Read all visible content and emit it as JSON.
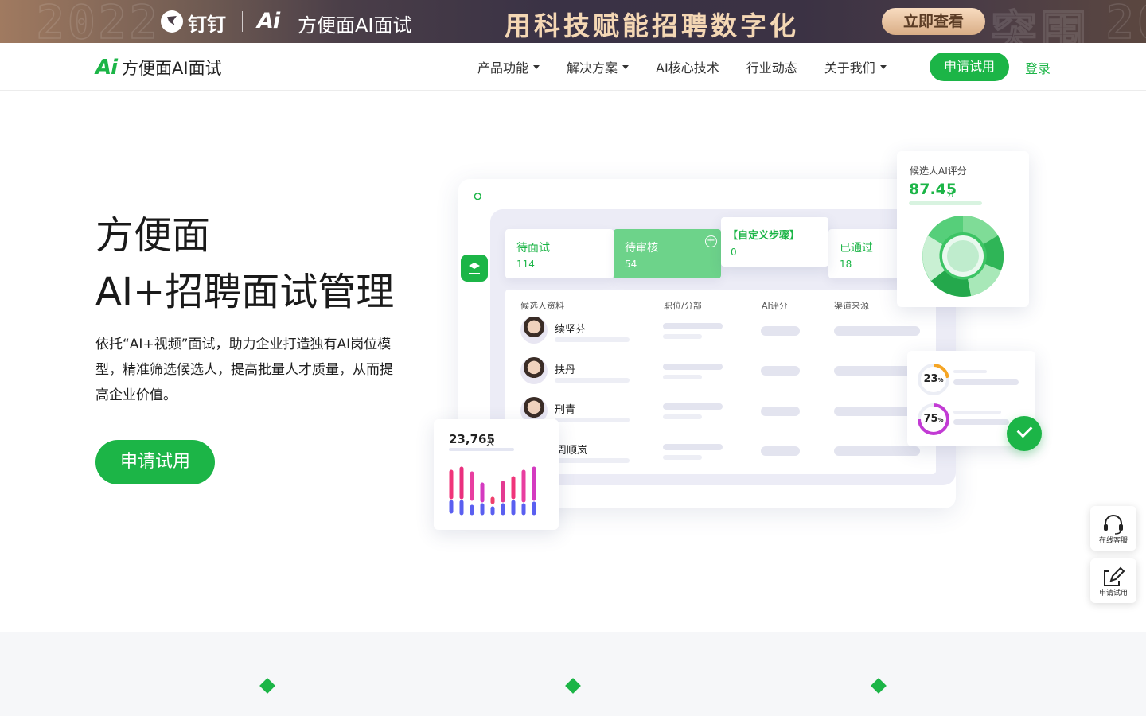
{
  "banner": {
    "ghost_text": "2022",
    "ghost_text_right": "突围",
    "ghost_text_far": "20",
    "dingtalk_label": "钉钉",
    "ai_mark": "Ai",
    "brand_label": "方便面AI面试",
    "slogan": "用科技赋能招聘数字化",
    "cta_label": "立即查看"
  },
  "header": {
    "logo_mark": "Ai",
    "logo_name": "方便面AI面试",
    "nav": [
      {
        "label": "产品功能",
        "has_dropdown": true
      },
      {
        "label": "解决方案",
        "has_dropdown": true
      },
      {
        "label": "AI核心技术",
        "has_dropdown": false
      },
      {
        "label": "行业动态",
        "has_dropdown": false
      },
      {
        "label": "关于我们",
        "has_dropdown": true
      }
    ],
    "apply_label": "申请试用",
    "login_label": "登录"
  },
  "hero": {
    "title_line1": "方便面",
    "title_line2": "AI+招聘面试管理",
    "description": "依托“AI+视频”面试，助力企业打造独有AI岗位模型，精准筛选候选人，提高批量人才质量，从而提高企业价值。",
    "cta_label": "申请试用"
  },
  "illustration": {
    "stages": [
      {
        "label": "待面试",
        "count": "114"
      },
      {
        "label": "待审核",
        "count": "54"
      },
      {
        "label": "【自定义步骤】",
        "count": "0"
      },
      {
        "label": "已通过",
        "count": "18"
      }
    ],
    "table_headers": [
      "候选人资料",
      "职位/分部",
      "AI评分",
      "渠道来源"
    ],
    "candidates": [
      "续坚芬",
      "扶丹",
      "刑青",
      "周顺岚"
    ],
    "score_card": {
      "title": "候选人AI评分",
      "value": "87.45",
      "unit": "分"
    },
    "count_card": {
      "value": "23,765",
      "unit": "人"
    },
    "percent_card": [
      {
        "value": "23",
        "unit": "%",
        "color": "#f5a524"
      },
      {
        "value": "75",
        "unit": "%",
        "color": "#c23bd4"
      }
    ],
    "colors": {
      "brand_green": "#1cb547",
      "bar_pink": "#f0357a",
      "bar_blue": "#5a5ff0"
    }
  },
  "side_tools": [
    {
      "label": "在线客服",
      "icon": "headset-icon"
    },
    {
      "label": "申请试用",
      "icon": "edit-icon"
    }
  ]
}
